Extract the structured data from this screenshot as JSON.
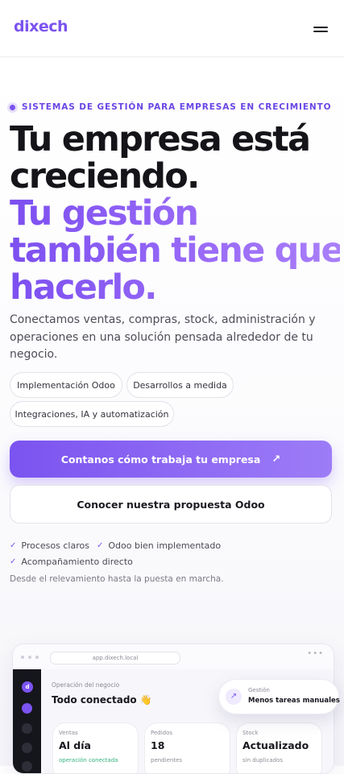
{
  "header": {
    "logo": "dixech",
    "menu_icon": "hamburger-menu-icon"
  },
  "hero": {
    "eyebrow": "SISTEMAS DE GESTIÓN PARA EMPRESAS EN CRECIMIENTO",
    "headline_dark": [
      "Tu empresa está",
      "creciendo."
    ],
    "headline_accent": [
      "Tu gestión",
      "también tiene que",
      "hacerlo."
    ],
    "lead": "Conectamos ventas, compras, stock, administración y operaciones en una solución pensada alrededor de tu negocio.",
    "chips": [
      "Implementación Odoo",
      "Desarrollos a medida",
      "Integraciones, IA y automatización"
    ],
    "primary_cta": "Contanos cómo trabaja tu empresa",
    "primary_cta_icon": "arrow-up-right-icon",
    "secondary_cta": "Conocer nuestra propuesta Odoo",
    "checks": [
      "Procesos claros",
      "Odoo bien implementado",
      "Acompañamiento directo"
    ],
    "note": "Desde el relevamiento hasta la puesta en marcha.",
    "accent_color": "#7b53f0"
  },
  "mockup": {
    "url": "app.dixech.local",
    "avatar": "d",
    "section_label": "Operación del negocio",
    "title": "Todo conectado 👋",
    "cards": [
      {
        "label": "Ventas",
        "value": "Al día",
        "sub": "operación conectada"
      },
      {
        "label": "Pedidos",
        "value": "18",
        "sub": "pendientes"
      },
      {
        "label": "Stock",
        "value": "Actualizado",
        "sub": "sin duplicados"
      }
    ],
    "float": {
      "label": "Gestión",
      "value": "Menos tareas manuales",
      "icon": "arrow-up-right-icon"
    }
  }
}
